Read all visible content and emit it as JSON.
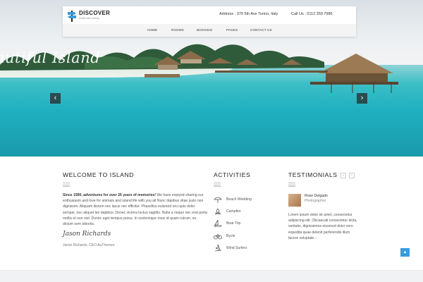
{
  "colors": {
    "accent": "#3a9bd9",
    "sea": "#1fb0bf",
    "nav_bg": "#f4f4f4"
  },
  "header": {
    "logo_title": "DISCOVER",
    "logo_sub": "Muliticrafts holiday",
    "logo_icon": "signpost-icon",
    "address": "Address : 379 5th Ave Torino, Italy",
    "phone": "Call Us : 0112 350 7986",
    "nav": [
      "HOME",
      "ROOMS",
      "BOOKING",
      "PAGES",
      "CONTACT US"
    ]
  },
  "hero": {
    "caption": "autiful Island",
    "prev_icon": "chevron-left-icon",
    "next_icon": "chevron-right-icon",
    "prev_glyph": "‹",
    "next_glyph": "›"
  },
  "welcome": {
    "title": "WELCOME TO ISLAND",
    "lead": "Since 1990, adventures for over 26 years of memories!",
    "body": " We have enjoyed sharing our enthusiasm and love for animals and island life with you alt Nunc dapibus vitae justo non dignissim. Aliquam dictum nec lacus nec efficitur. Phasellus euismod orci quis dolor semper, nec aliquet leo dapibus. Donec viverra luctus sagittis. Nulla a neque nec erat porta mollis et non nisl. Donec eget tempus purus. In scelerisque risus id quam rutrum, eu dictum sem lobortis.",
    "signature": "Jason Richards",
    "signature_caption": "Jason Richards, CEO AuThemes"
  },
  "activities": {
    "title": "ACTIVITIES",
    "items": [
      {
        "label": "Beach Wedding",
        "icon": "beach-umbrella-icon"
      },
      {
        "label": "Campfire",
        "icon": "campfire-icon"
      },
      {
        "label": "Boat Trip",
        "icon": "sailboat-icon"
      },
      {
        "label": "Bycle",
        "icon": "bicycle-icon"
      },
      {
        "label": "Wind Surfers",
        "icon": "windsurf-icon"
      }
    ]
  },
  "testimonials": {
    "title": "TESTIMONIALS",
    "prev_glyph": "‹",
    "next_glyph": "›",
    "name": "Rose Delgado",
    "role": "Photographer",
    "text": "Lorem ipsum dolor sit amet, consectetur adipiscing elit. Obcaecati consectetur dicta, veritatis, dignissimos eiusmod dolor vero expedita quae delenit perferendis illum facere voluptate..."
  },
  "scroll_top_glyph": "▲"
}
